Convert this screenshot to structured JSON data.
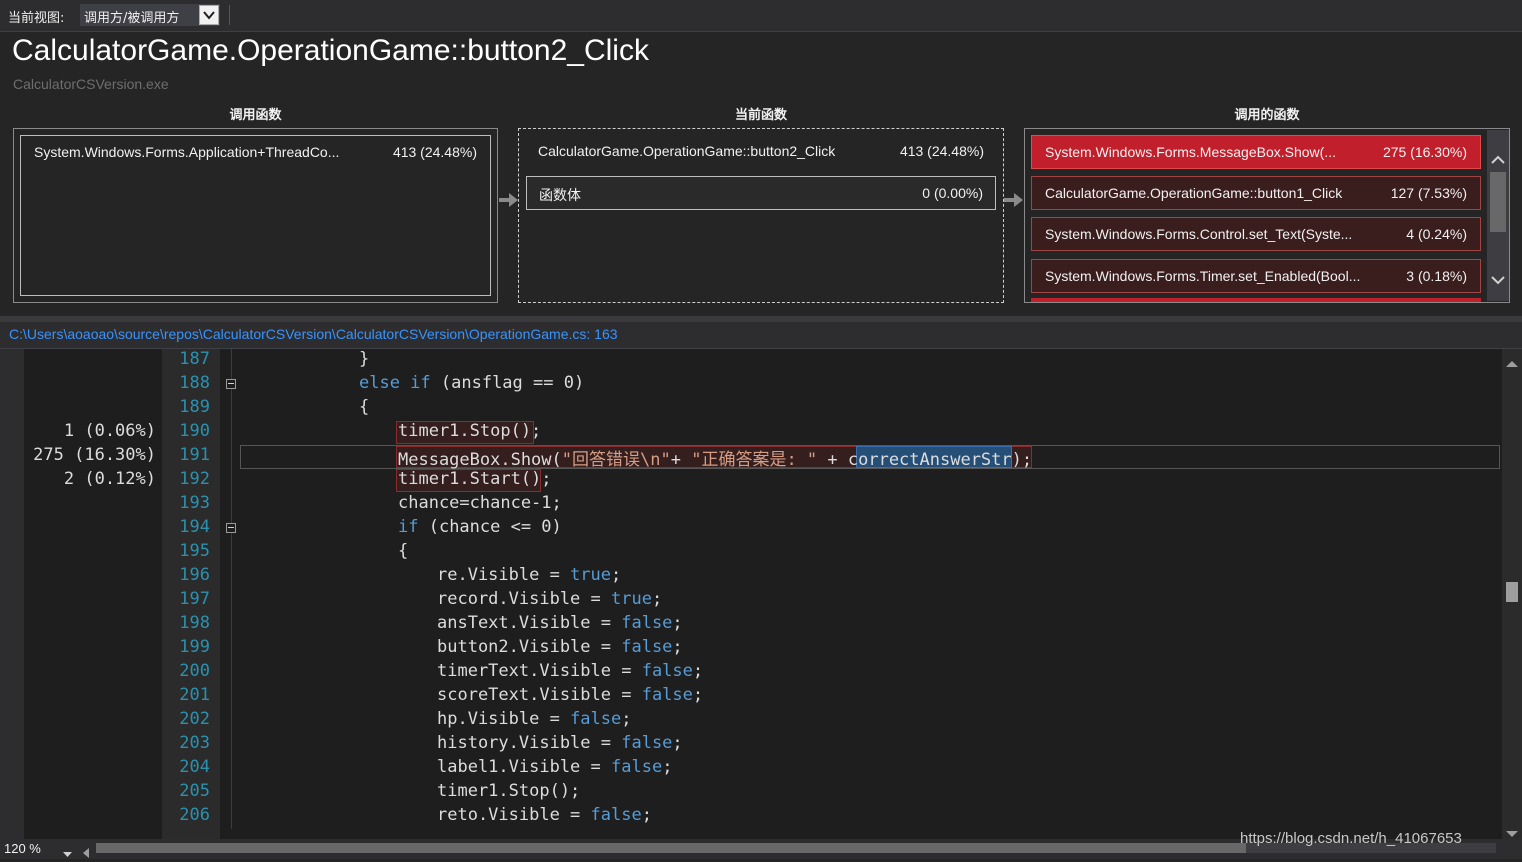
{
  "topbar": {
    "view_label": "当前视图:",
    "view_selected": "调用方/被调用方"
  },
  "function": {
    "title": "CalculatorGame.OperationGame::button2_Click",
    "module": "CalculatorCSVersion.exe"
  },
  "columns": {
    "callers": "调用函数",
    "current": "当前函数",
    "callees": "调用的函数"
  },
  "callers": [
    {
      "name": "System.Windows.Forms.Application+ThreadCo...",
      "value": "413 (24.48%)"
    }
  ],
  "current": {
    "name": "CalculatorGame.OperationGame::button2_Click",
    "value": "413 (24.48%)",
    "body_label": "函数体",
    "body_value": "0 (0.00%)"
  },
  "callees": [
    {
      "name": "System.Windows.Forms.MessageBox.Show(...",
      "value": "275 (16.30%)"
    },
    {
      "name": "CalculatorGame.OperationGame::button1_Click",
      "value": "127 (7.53%)"
    },
    {
      "name": "System.Windows.Forms.Control.set_Text(Syste...",
      "value": "4 (0.24%)"
    },
    {
      "name": "System.Windows.Forms.Timer.set_Enabled(Bool...",
      "value": "3 (0.18%)"
    }
  ],
  "file": {
    "path": "C:\\Users\\aoaoao\\source\\repos\\CalculatorCSVersion\\CalculatorCSVersion\\OperationGame.cs: 163"
  },
  "code": {
    "line_numbers": [
      "187",
      "188",
      "189",
      "190",
      "191",
      "192",
      "193",
      "194",
      "195",
      "196",
      "197",
      "198",
      "199",
      "200",
      "201",
      "202",
      "203",
      "204",
      "205",
      "206"
    ],
    "metrics": {
      "190": "1 (0.06%)",
      "191": "275 (16.30%)",
      "192": "2 (0.12%)"
    },
    "lines": {
      "l187": "}",
      "l188_kw": "else if",
      "l188_rest": " (ansflag == 0)",
      "l189": "{",
      "l190": "timer1.Stop();",
      "l191_a": "MessageBox.Show(",
      "l191_s1": "\"回答错误\\n\"",
      "l191_b": "+ ",
      "l191_s2": "\"正确答案是: \"",
      "l191_c": " + ",
      "l191_sel": "correctAnswerStr",
      "l191_d": ");",
      "l192": "timer1.Start();",
      "l193": "chance=chance-1;",
      "l194_kw": "if",
      "l194_rest": " (chance <= 0)",
      "l195": "{",
      "assign": [
        {
          "lhs": "re.Visible = ",
          "val": "true",
          "end": ";"
        },
        {
          "lhs": "record.Visible = ",
          "val": "true",
          "end": ";"
        },
        {
          "lhs": "ansText.Visible = ",
          "val": "false",
          "end": ";"
        },
        {
          "lhs": "button2.Visible = ",
          "val": "false",
          "end": ";"
        },
        {
          "lhs": "timerText.Visible = ",
          "val": "false",
          "end": ";"
        },
        {
          "lhs": "scoreText.Visible = ",
          "val": "false",
          "end": ";"
        },
        {
          "lhs": "hp.Visible = ",
          "val": "false",
          "end": ";"
        },
        {
          "lhs": "history.Visible = ",
          "val": "false",
          "end": ";"
        },
        {
          "lhs": "label1.Visible = ",
          "val": "false",
          "end": ";"
        }
      ],
      "l205": "timer1.Stop();",
      "l206_lhs": "reto.Visible = ",
      "l206_val": "false",
      "l206_end": ";"
    }
  },
  "status": {
    "zoom": "120 %",
    "watermark": "https://blog.csdn.net/h_41067653"
  },
  "colors": {
    "hot_callee": "#c21f2c",
    "keyword": "#569cd6",
    "line_number": "#2b91af",
    "path_link": "#3794ff"
  }
}
